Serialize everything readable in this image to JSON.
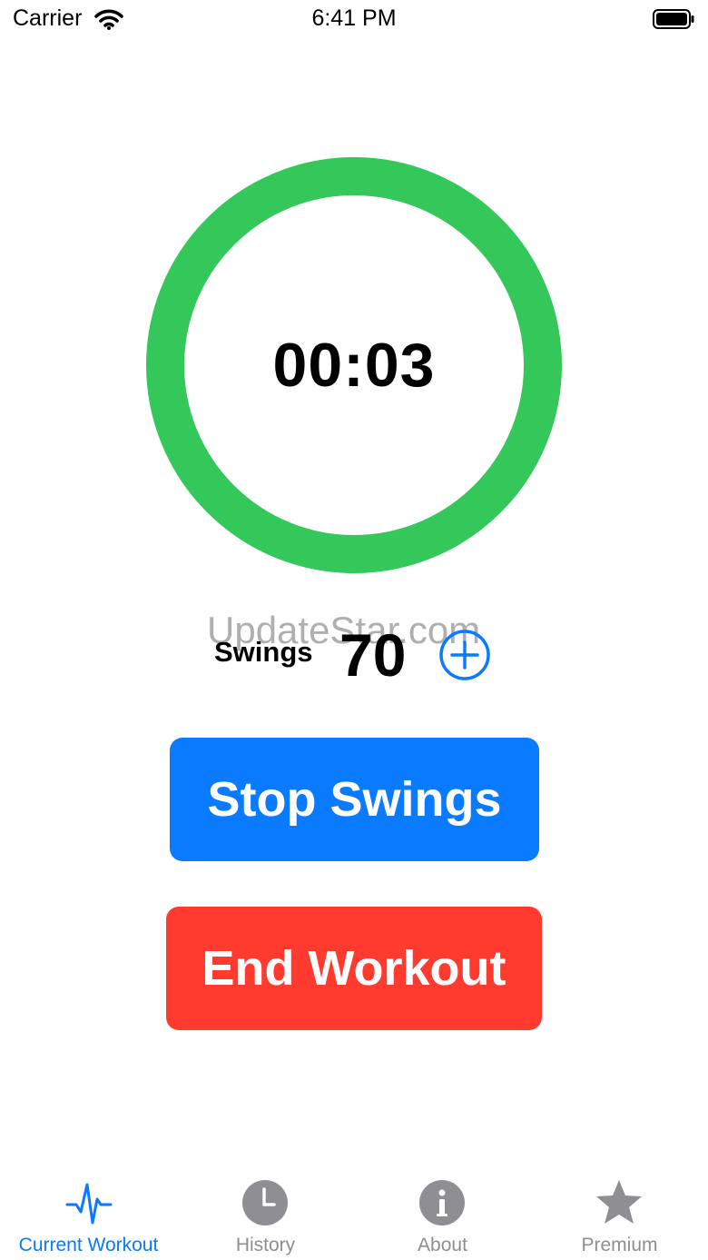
{
  "status_bar": {
    "carrier": "Carrier",
    "time": "6:41 PM",
    "icons": [
      "wifi-icon",
      "battery-icon"
    ]
  },
  "timer": {
    "value": "00:03",
    "ring_color": "#34c759"
  },
  "swings": {
    "label": "Swings",
    "count": "70",
    "add_icon": "plus-circle-icon"
  },
  "watermark": "UpdateStar.com",
  "buttons": {
    "stop_label": "Stop Swings",
    "stop_color": "#0a7aff",
    "end_label": "End Workout",
    "end_color": "#ff3b30"
  },
  "tab_bar": {
    "active_color": "#0a7aff",
    "inactive_color": "#8e8e93",
    "tabs": [
      {
        "label": "Current Workout",
        "icon": "heartbeat-icon",
        "active": true
      },
      {
        "label": "History",
        "icon": "clock-icon",
        "active": false
      },
      {
        "label": "About",
        "icon": "info-icon",
        "active": false
      },
      {
        "label": "Premium",
        "icon": "star-icon",
        "active": false
      }
    ]
  }
}
